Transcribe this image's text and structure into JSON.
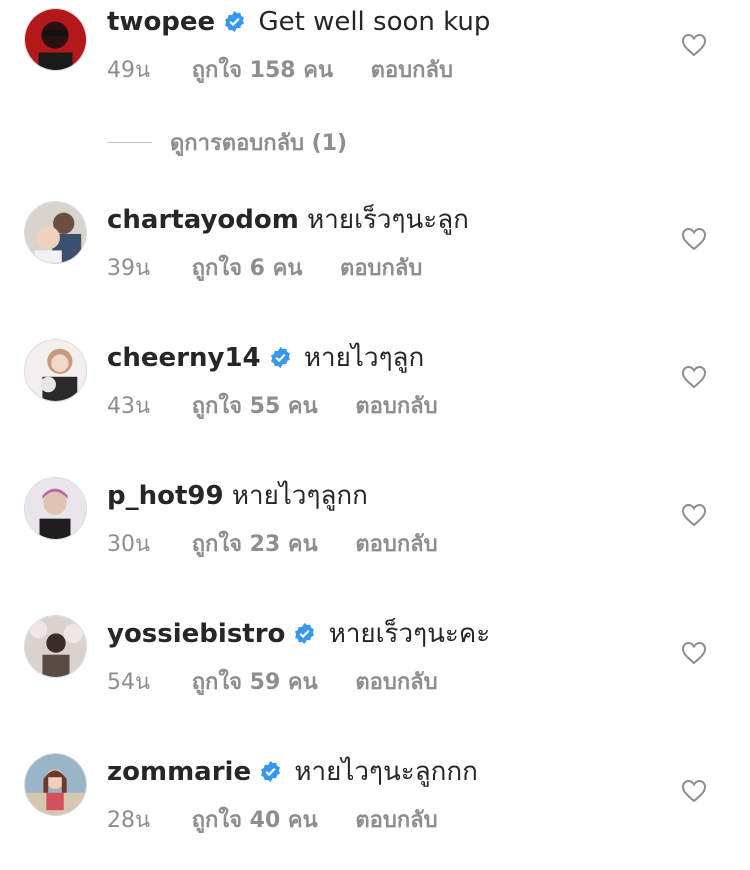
{
  "comments": [
    {
      "username": "twopee",
      "verified": true,
      "text": "Get well soon kup",
      "time": "49น",
      "likes": "ถูกใจ 158 คน",
      "reply": "ตอบกลับ"
    },
    {
      "username": "chartayodom",
      "verified": false,
      "text": "หายเร็วๆนะลูก",
      "time": "39น",
      "likes": "ถูกใจ 6 คน",
      "reply": "ตอบกลับ"
    },
    {
      "username": "cheerny14",
      "verified": true,
      "text": "หายไวๆลูก",
      "time": "43น",
      "likes": "ถูกใจ 55 คน",
      "reply": "ตอบกลับ"
    },
    {
      "username": "p_hot99",
      "verified": false,
      "text": "หายไวๆลูกก",
      "time": "30น",
      "likes": "ถูกใจ 23 คน",
      "reply": "ตอบกลับ"
    },
    {
      "username": "yossiebistro",
      "verified": true,
      "text": "หายเร็วๆนะคะ",
      "time": "54น",
      "likes": "ถูกใจ 59 คน",
      "reply": "ตอบกลับ"
    },
    {
      "username": "zommarie",
      "verified": true,
      "text": "หายไวๆนะลูกกก",
      "time": "28น",
      "likes": "ถูกใจ 40 คน",
      "reply": "ตอบกลับ"
    }
  ],
  "view_replies": "ดูการตอบกลับ (1)",
  "colors": {
    "verified": "#3897f0",
    "muted": "#8e8e8e",
    "text": "#262626"
  }
}
